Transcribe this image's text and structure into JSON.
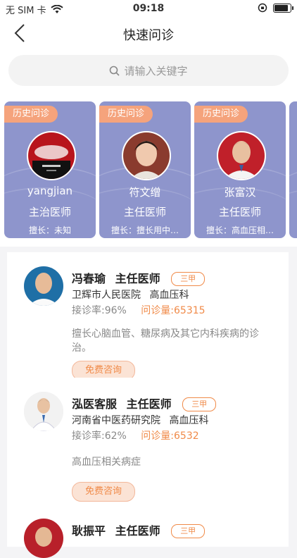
{
  "status_bar": {
    "carrier": "无 SIM 卡",
    "time": "09:18"
  },
  "nav": {
    "title": "快速问诊"
  },
  "search": {
    "placeholder": "请输入关键字"
  },
  "history_cards": [
    {
      "tag": "历史问诊",
      "name": "yangjian",
      "rank": "主治医师",
      "skill": "擅长：未知"
    },
    {
      "tag": "历史问诊",
      "name": "符文缯",
      "rank": "主任医师",
      "skill": "擅长：擅长用中…"
    },
    {
      "tag": "历史问诊",
      "name": "张富汉",
      "rank": "主任医师",
      "skill": "擅长：高血压相…"
    }
  ],
  "doctors": [
    {
      "name": "冯春瑜",
      "title": "主任医师",
      "level": "三甲",
      "hospital": "卫辉市人民医院",
      "dept": "高血压科",
      "rate_label": "接诊率:",
      "rate": "96%",
      "volume_label": "问诊量:",
      "volume": "65315",
      "desc": "擅长心脑血管、糖尿病及其它内科疾病的诊治。",
      "button": "免费咨询"
    },
    {
      "name": "泓医客服",
      "title": "主任医师",
      "level": "三甲",
      "hospital": "河南省中医药研究院",
      "dept": "高血压科",
      "rate_label": "接诊率:",
      "rate": "62%",
      "volume_label": "问诊量:",
      "volume": "6532",
      "desc": "高血压相关病症",
      "button": "免费咨询"
    },
    {
      "name": "耿振平",
      "title": "主任医师",
      "level": "三甲"
    }
  ],
  "colors": {
    "card_bg": "#8e95cc",
    "tag_bg": "#f5a37c",
    "accent": "#f08a48"
  }
}
